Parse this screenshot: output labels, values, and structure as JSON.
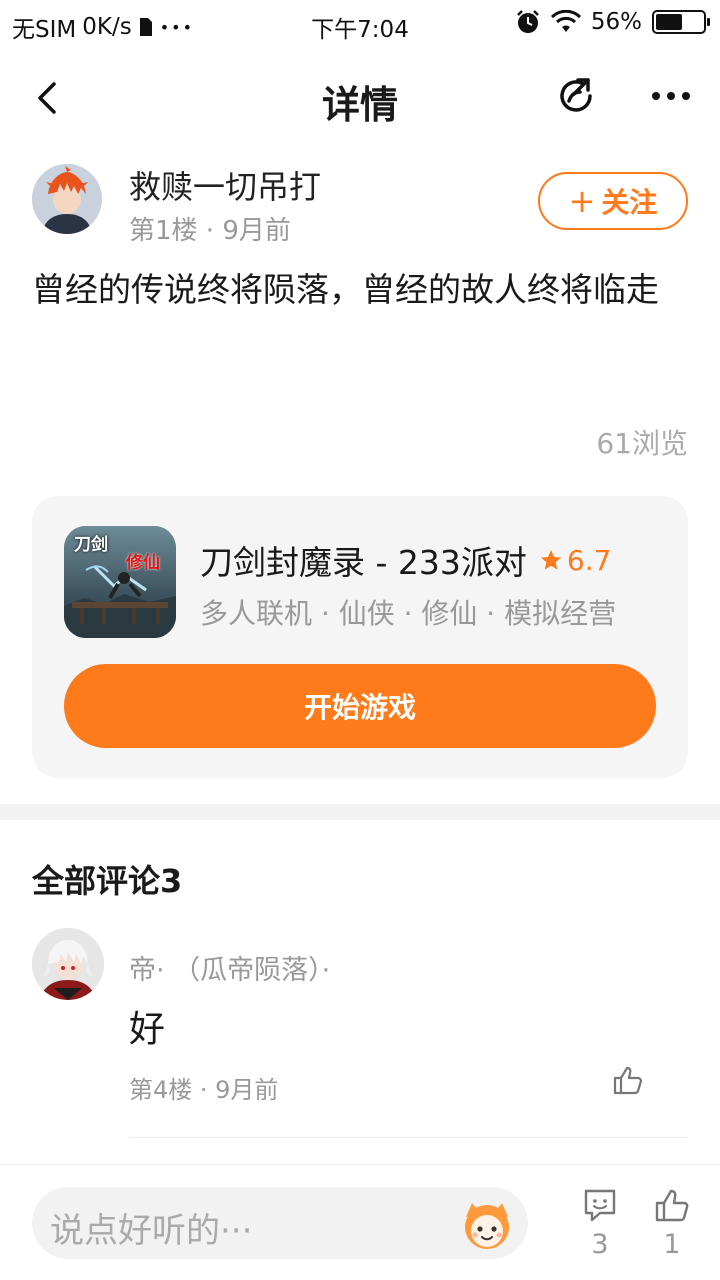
{
  "status_bar": {
    "carrier": "无SIM",
    "speed": "0K/s",
    "dots": "•••",
    "time": "下午7:04",
    "battery_pct": "56%",
    "battery_level": 0.56
  },
  "nav": {
    "title": "详情"
  },
  "post": {
    "author": "救赎一切吊打",
    "meta": "第1楼 · 9月前",
    "follow_label": "关注",
    "content": "曾经的传说终将陨落，曾经的故人终将临走",
    "views": "61浏览"
  },
  "game_card": {
    "title": "刀剑封魔录 - 233派对",
    "rating": "6.7",
    "tags": "多人联机 · 仙侠 · 修仙 · 模拟经营",
    "start_label": "开始游戏",
    "icon_text_left": "刀剑",
    "icon_text_right": "修仙"
  },
  "comments": {
    "title": "全部评论3",
    "items": [
      {
        "name": "帝· （瓜帝陨落）·",
        "text": "好",
        "meta": "第4楼 · 9月前"
      }
    ]
  },
  "bottom": {
    "placeholder": "说点好听的···",
    "comment_count": "3",
    "like_count": "1"
  },
  "colors": {
    "accent": "#ff7a1a",
    "muted": "#999999"
  }
}
